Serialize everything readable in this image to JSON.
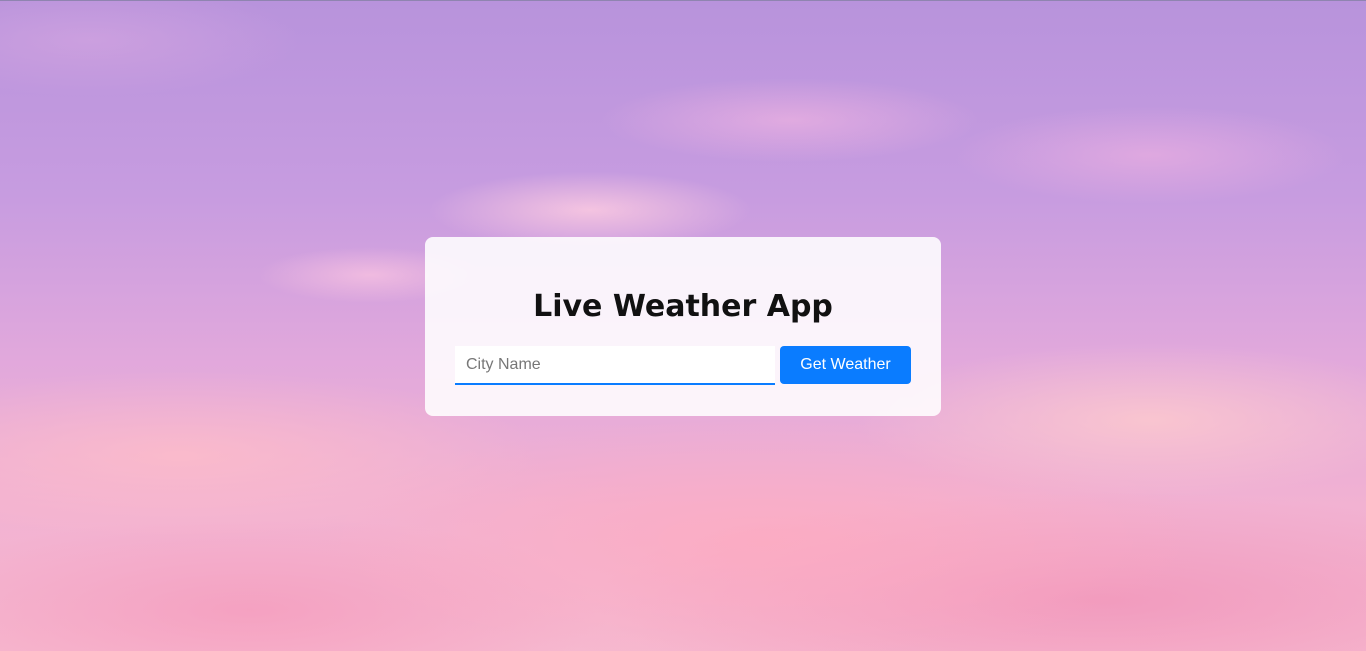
{
  "app": {
    "title": "Live Weather App"
  },
  "search": {
    "city_value": "",
    "city_placeholder": "City Name",
    "button_label": "Get Weather"
  },
  "colors": {
    "accent": "#0a7cff",
    "card_background": "#ffffff",
    "title_text": "#111111"
  }
}
